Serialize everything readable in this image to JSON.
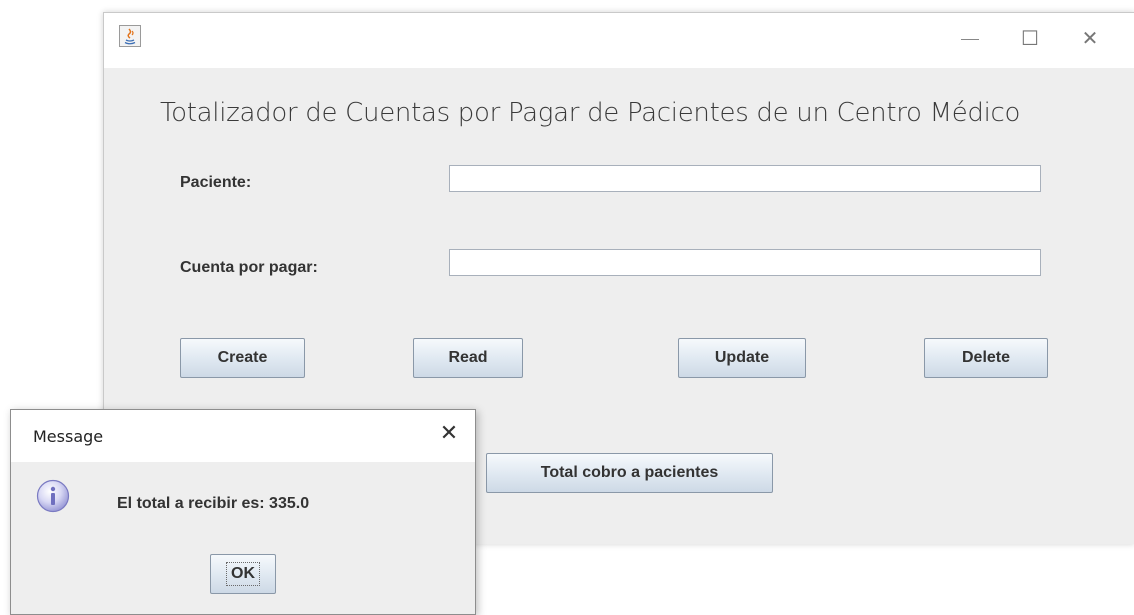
{
  "main_window": {
    "app_title": "Totalizador de Cuentas por Pagar de Pacientes de un Centro Médico",
    "icon": "java-icon",
    "controls": {
      "minimize_icon": "—",
      "maximize_icon": "☐",
      "close_icon": "✕"
    },
    "form": {
      "paciente_label": "Paciente:",
      "paciente_value": "",
      "cuenta_label": "Cuenta por pagar:",
      "cuenta_value": ""
    },
    "buttons": {
      "create": "Create",
      "read": "Read",
      "update": "Update",
      "delete": "Delete",
      "total": "Total cobro a pacientes"
    }
  },
  "dialog": {
    "title": "Message",
    "close_icon": "✕",
    "icon": "info-icon",
    "message": "El total a recibir es: 335.0",
    "ok_label": "OK"
  }
}
